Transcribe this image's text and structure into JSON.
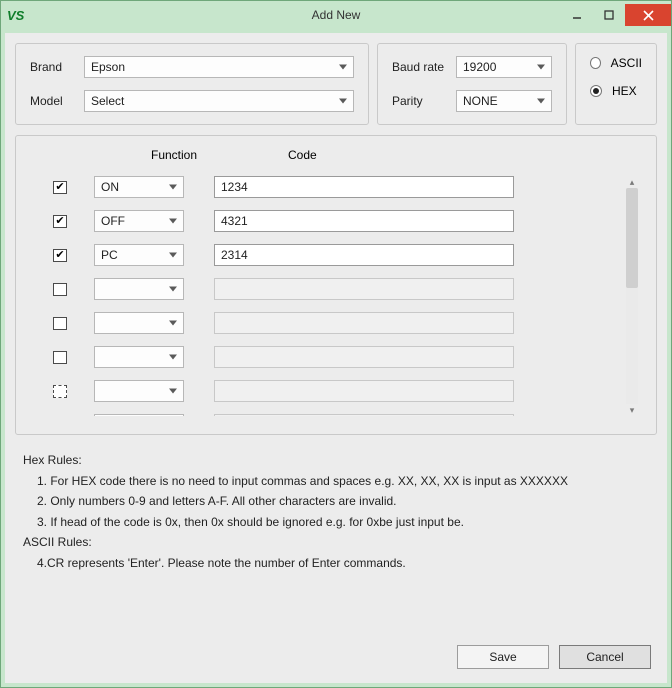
{
  "window": {
    "logo": "VS",
    "title": "Add New"
  },
  "brand": {
    "label": "Brand",
    "value": "Epson"
  },
  "model": {
    "label": "Model",
    "value": "Select"
  },
  "baud": {
    "label": "Baud rate",
    "value": "19200"
  },
  "parity": {
    "label": "Parity",
    "value": "NONE"
  },
  "format": {
    "ascii_label": "ASCII",
    "hex_label": "HEX",
    "selected": "HEX"
  },
  "grid": {
    "header_function": "Function",
    "header_code": "Code",
    "rows": [
      {
        "checked": true,
        "function": "ON",
        "code": "1234",
        "enabled": true
      },
      {
        "checked": true,
        "function": "OFF",
        "code": "4321",
        "enabled": true
      },
      {
        "checked": true,
        "function": "PC",
        "code": "2314",
        "enabled": true
      },
      {
        "checked": false,
        "function": "",
        "code": "",
        "enabled": false
      },
      {
        "checked": false,
        "function": "",
        "code": "",
        "enabled": false
      },
      {
        "checked": false,
        "function": "",
        "code": "",
        "enabled": false
      },
      {
        "checked": false,
        "function": "",
        "code": "",
        "enabled": false,
        "dashed": true
      },
      {
        "checked": false,
        "function": "",
        "code": "",
        "enabled": false
      }
    ]
  },
  "rules": {
    "hex_title": "Hex Rules:",
    "hex_1": "1. For HEX code there is no need to input commas and spaces e.g. XX, XX, XX  is input as XXXXXX",
    "hex_2": "2. Only numbers 0-9 and letters A-F. All other characters are invalid.",
    "hex_3": "3. If head of the code is 0x, then 0x should be ignored e.g. for 0xbe just input be.",
    "ascii_title": "ASCII Rules:",
    "ascii_4": "4.CR represents 'Enter'. Please note the number of Enter commands."
  },
  "buttons": {
    "save": "Save",
    "cancel": "Cancel"
  }
}
